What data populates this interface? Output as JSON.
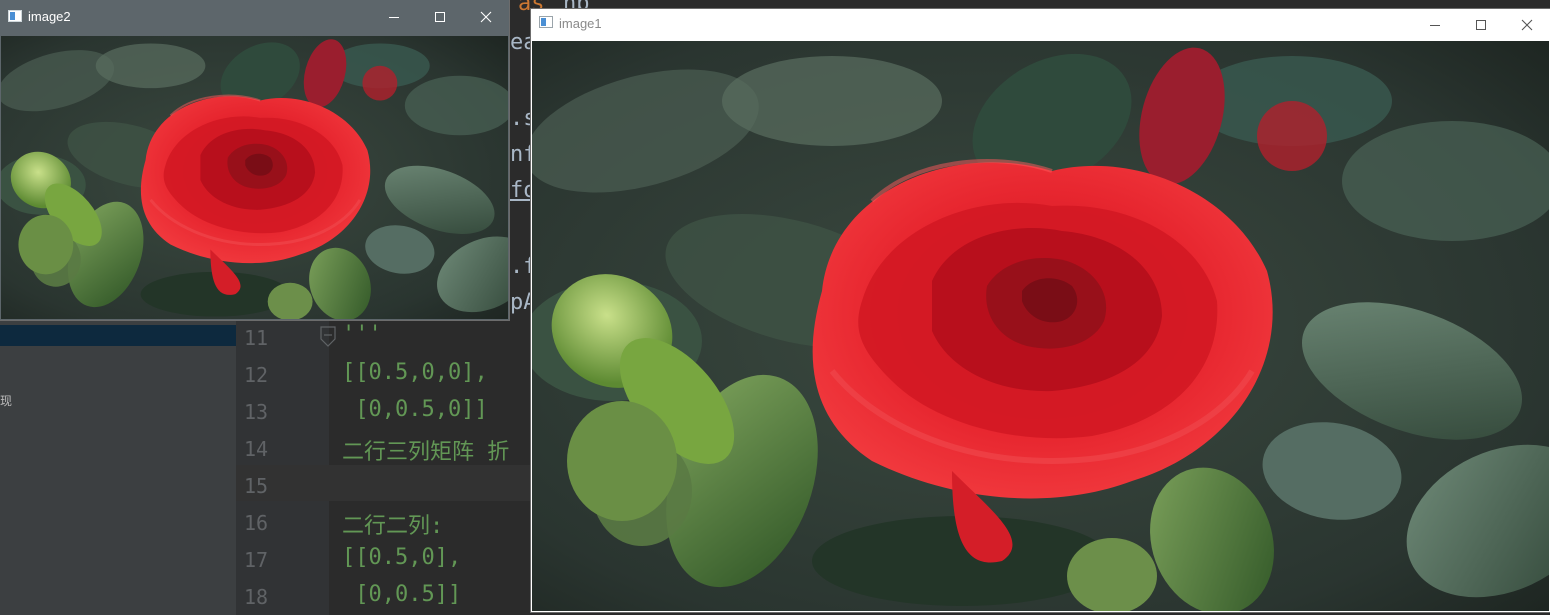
{
  "ide": {
    "sidebar_fragment": "现",
    "fragments": {
      "as": "as",
      "np": "np",
      "ea": "ea",
      "s": ".s",
      "nf": "nf",
      "fo": "fo",
      "f": ".f",
      "pa": "pA"
    },
    "lines": [
      {
        "num": "11",
        "code": "'''"
      },
      {
        "num": "12",
        "code": "[[0.5,0,0],"
      },
      {
        "num": "13",
        "code": " [0,0.5,0]]"
      },
      {
        "num": "14",
        "code": "二行三列矩阵 折"
      },
      {
        "num": "15",
        "code": ""
      },
      {
        "num": "16",
        "code": "二行二列:"
      },
      {
        "num": "17",
        "code": "[[0.5,0],"
      },
      {
        "num": "18",
        "code": " [0,0.5]]"
      }
    ]
  },
  "window2": {
    "title": "image2",
    "icon": "app-window-icon",
    "controls": [
      "minimize-icon",
      "maximize-icon",
      "close-icon"
    ]
  },
  "window1": {
    "title": "image1",
    "icon": "app-window-icon",
    "controls": [
      "minimize-icon",
      "maximize-icon",
      "close-icon"
    ]
  },
  "colors": {
    "rose": "#e0202c",
    "leaf": "#3f5a44",
    "ide_bg": "#2b2b2b",
    "code_green": "#629755"
  }
}
